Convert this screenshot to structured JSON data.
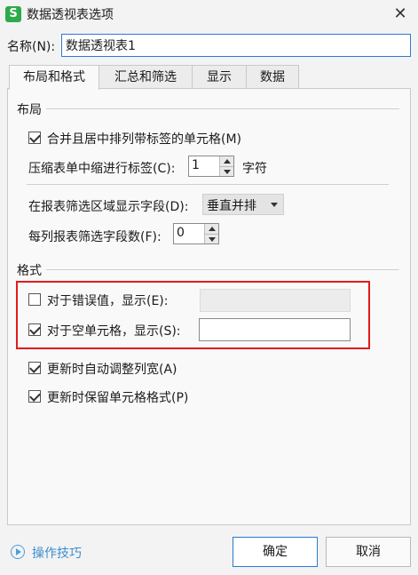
{
  "dialog": {
    "app_icon": "S",
    "title": "数据透视表选项",
    "close_glyph": "✕"
  },
  "name": {
    "label": "名称(N):",
    "value": "数据透视表1"
  },
  "tabs": [
    {
      "label": "布局和格式",
      "active": true
    },
    {
      "label": "汇总和筛选",
      "active": false
    },
    {
      "label": "显示",
      "active": false
    },
    {
      "label": "数据",
      "active": false
    }
  ],
  "layout": {
    "section_title": "布局",
    "merge_center": {
      "label": "合并且居中排列带标签的单元格(M)",
      "checked": true
    },
    "indent": {
      "label": "压缩表单中缩进行标签(C):",
      "value": "1",
      "unit": "字符"
    },
    "filter_order": {
      "label": "在报表筛选区域显示字段(D):",
      "value": "垂直并排"
    },
    "fields_per_column": {
      "label": "每列报表筛选字段数(F):",
      "value": "0"
    }
  },
  "format": {
    "section_title": "格式",
    "error_values": {
      "label": "对于错误值，显示(E):",
      "checked": false,
      "value": ""
    },
    "empty_cells": {
      "label": "对于空单元格，显示(S):",
      "checked": true,
      "value": ""
    },
    "autofit": {
      "label": "更新时自动调整列宽(A)",
      "checked": true
    },
    "preserve": {
      "label": "更新时保留单元格格式(P)",
      "checked": true
    }
  },
  "footer": {
    "help_label": "操作技巧",
    "ok_label": "确定",
    "cancel_label": "取消"
  },
  "colors": {
    "accent": "#2b79d8",
    "highlight": "#e21b1b",
    "app_icon": "#2eaa4a",
    "help": "#3a8ed0"
  }
}
